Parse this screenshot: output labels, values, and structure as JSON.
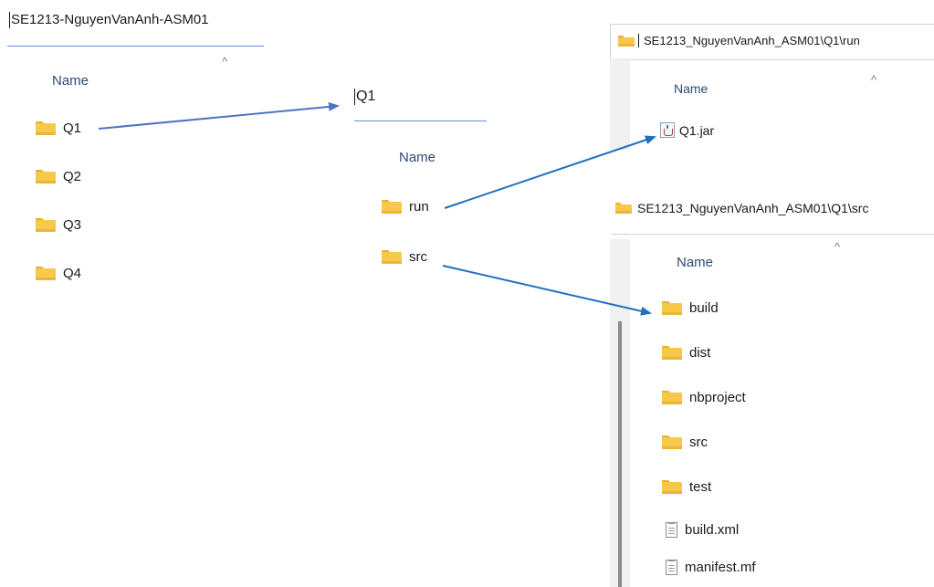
{
  "left_panel": {
    "path": "SE1213-NguyenVanAnh-ASM01",
    "column_header": "Name",
    "items": [
      "Q1",
      "Q2",
      "Q3",
      "Q4"
    ]
  },
  "middle_panel": {
    "path": "Q1",
    "column_header": "Name",
    "items": [
      "run",
      "src"
    ]
  },
  "run_panel": {
    "path": "SE1213_NguyenVanAnh_ASM01\\Q1\\run",
    "column_header": "Name",
    "items": [
      "Q1.jar"
    ]
  },
  "src_panel": {
    "path": "SE1213_NguyenVanAnh_ASM01\\Q1\\src",
    "column_header": "Name",
    "folders": [
      "build",
      "dist",
      "nbproject",
      "src",
      "test"
    ],
    "files": [
      "build.xml",
      "manifest.mf"
    ]
  },
  "colors": {
    "folder": "#f7c84a",
    "arrow_left": "#4f72c4",
    "arrow_right": "#1f6fbf",
    "underline": "#5b8fd6"
  },
  "icons": {
    "folder": "folder-icon",
    "file": "file-icon",
    "jar": "java-jar-icon",
    "sort": "sort-caret-icon"
  }
}
